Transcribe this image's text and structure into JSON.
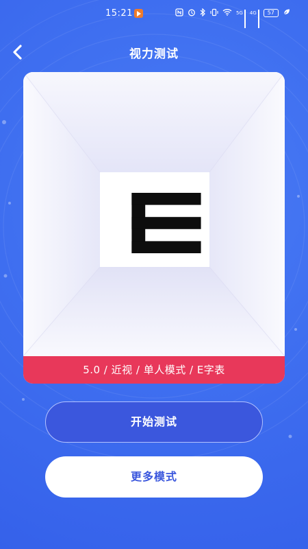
{
  "status_bar": {
    "time": "15:21",
    "network_5g": "5G",
    "network_4g": "4G",
    "battery": "57"
  },
  "header": {
    "title": "视力测试",
    "back_icon": "chevron-left-icon"
  },
  "test_card": {
    "letter": "E",
    "caption": "5.0 / 近视 / 单人模式 / E字表"
  },
  "actions": {
    "start_label": "开始测试",
    "more_label": "更多模式"
  },
  "colors": {
    "background": "#3f6ff0",
    "caption_bar": "#e8385a",
    "primary_button": "#3b57dd",
    "secondary_button_text": "#3b57dd"
  }
}
